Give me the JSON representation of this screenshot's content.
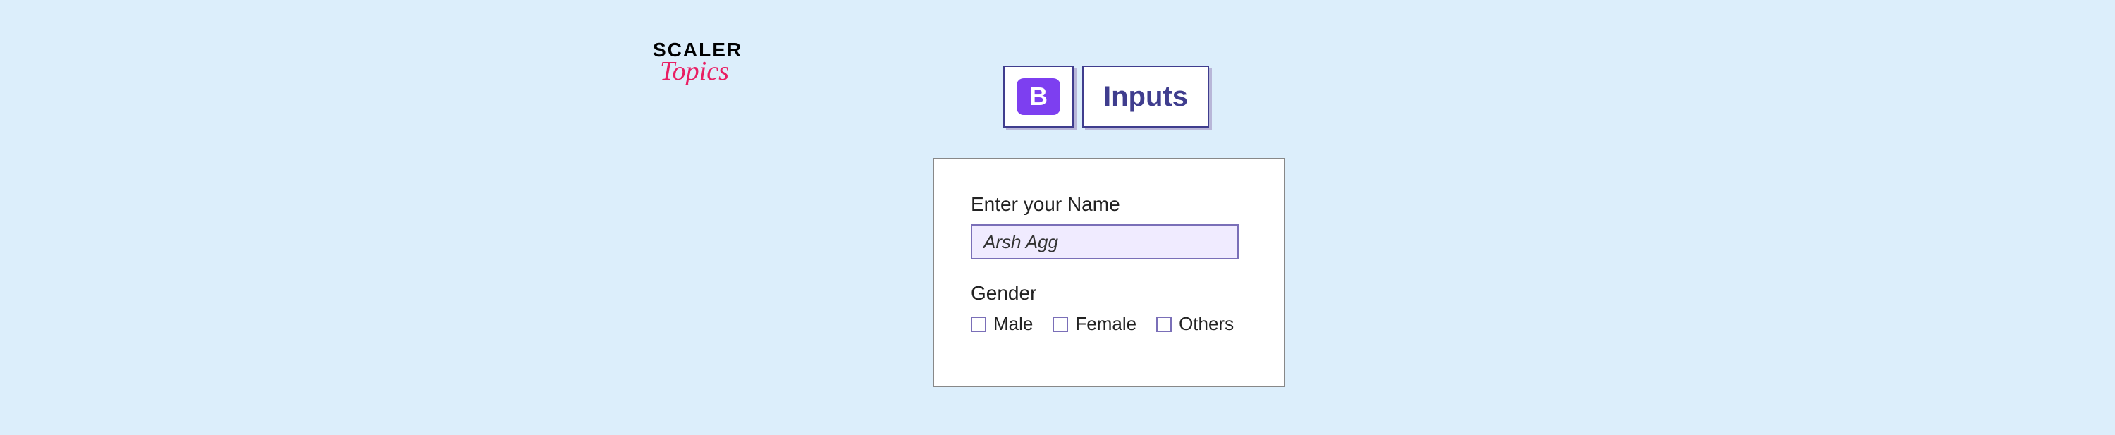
{
  "logo": {
    "line1": "SCALER",
    "line2": "Topics"
  },
  "badge": {
    "label": "Inputs"
  },
  "form": {
    "name_label": "Enter your Name",
    "name_value": "Arsh Agg",
    "gender_label": "Gender",
    "options": {
      "male": "Male",
      "female": "Female",
      "others": "Others"
    }
  }
}
